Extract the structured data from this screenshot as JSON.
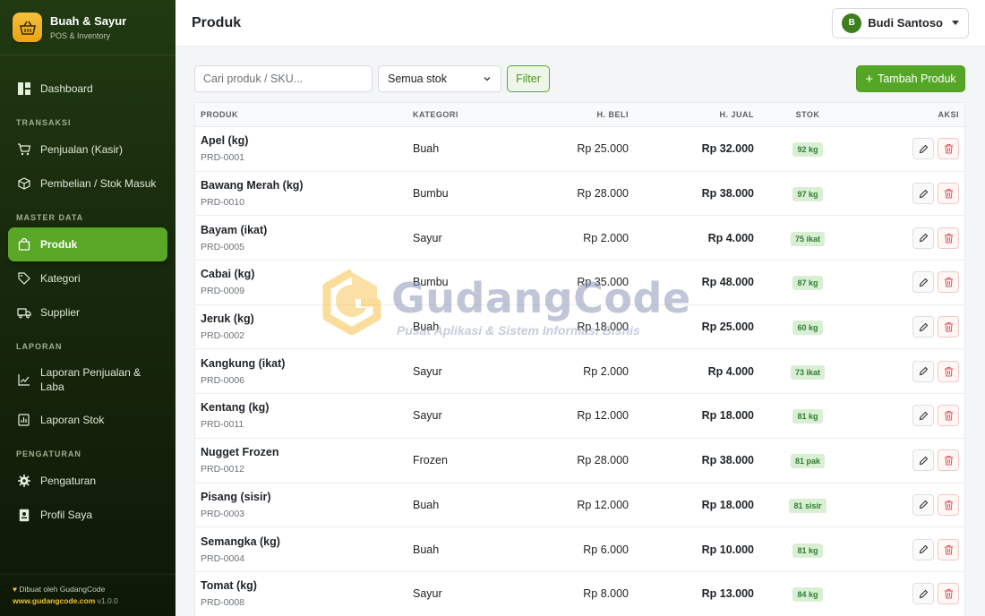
{
  "brand": {
    "name": "Buah & Sayur",
    "tagline": "POS & Inventory"
  },
  "sidebar": {
    "dashboard": "Dashboard",
    "sections": {
      "transaksi": "TRANSAKSI",
      "master": "MASTER DATA",
      "laporan": "LAPORAN",
      "pengaturan": "PENGATURAN"
    },
    "items": {
      "penjualan": "Penjualan (Kasir)",
      "pembelian": "Pembelian / Stok Masuk",
      "produk": "Produk",
      "kategori": "Kategori",
      "supplier": "Supplier",
      "lap_penjualan": "Laporan Penjualan & Laba",
      "lap_stok": "Laporan Stok",
      "pengaturan": "Pengaturan",
      "profil": "Profil Saya"
    },
    "footer": {
      "made_by": "Dibuat oleh GudangCode",
      "url": "www.gudangcode.com",
      "version": "v1.0.0"
    }
  },
  "header": {
    "title": "Produk",
    "user_initial": "B",
    "user_name": "Budi Santoso"
  },
  "toolbar": {
    "search_placeholder": "Cari produk / SKU...",
    "stock_filter": "Semua stok",
    "filter_label": "Filter",
    "add_label": "Tambah Produk"
  },
  "table": {
    "headers": {
      "produk": "PRODUK",
      "kategori": "KATEGORI",
      "beli": "H. BELI",
      "jual": "H. JUAL",
      "stok": "STOK",
      "aksi": "AKSI"
    },
    "rows": [
      {
        "name": "Apel (kg)",
        "sku": "PRD-0001",
        "kategori": "Buah",
        "beli": "Rp 25.000",
        "jual": "Rp 32.000",
        "stok": "92 kg"
      },
      {
        "name": "Bawang Merah (kg)",
        "sku": "PRD-0010",
        "kategori": "Bumbu",
        "beli": "Rp 28.000",
        "jual": "Rp 38.000",
        "stok": "97 kg"
      },
      {
        "name": "Bayam (ikat)",
        "sku": "PRD-0005",
        "kategori": "Sayur",
        "beli": "Rp 2.000",
        "jual": "Rp 4.000",
        "stok": "75 ikat"
      },
      {
        "name": "Cabai (kg)",
        "sku": "PRD-0009",
        "kategori": "Bumbu",
        "beli": "Rp 35.000",
        "jual": "Rp 48.000",
        "stok": "87 kg"
      },
      {
        "name": "Jeruk (kg)",
        "sku": "PRD-0002",
        "kategori": "Buah",
        "beli": "Rp 18.000",
        "jual": "Rp 25.000",
        "stok": "60 kg"
      },
      {
        "name": "Kangkung (ikat)",
        "sku": "PRD-0006",
        "kategori": "Sayur",
        "beli": "Rp 2.000",
        "jual": "Rp 4.000",
        "stok": "73 ikat"
      },
      {
        "name": "Kentang (kg)",
        "sku": "PRD-0011",
        "kategori": "Sayur",
        "beli": "Rp 12.000",
        "jual": "Rp 18.000",
        "stok": "81 kg"
      },
      {
        "name": "Nugget Frozen",
        "sku": "PRD-0012",
        "kategori": "Frozen",
        "beli": "Rp 28.000",
        "jual": "Rp 38.000",
        "stok": "81 pak"
      },
      {
        "name": "Pisang (sisir)",
        "sku": "PRD-0003",
        "kategori": "Buah",
        "beli": "Rp 12.000",
        "jual": "Rp 18.000",
        "stok": "81 sisir"
      },
      {
        "name": "Semangka (kg)",
        "sku": "PRD-0004",
        "kategori": "Buah",
        "beli": "Rp 6.000",
        "jual": "Rp 10.000",
        "stok": "81 kg"
      },
      {
        "name": "Tomat (kg)",
        "sku": "PRD-0008",
        "kategori": "Sayur",
        "beli": "Rp 8.000",
        "jual": "Rp 13.000",
        "stok": "84 kg"
      }
    ]
  },
  "watermark": {
    "title": "GudangCode",
    "subtitle": "Pusat Aplikasi & Sistem Informasi Bisnis"
  },
  "colors": {
    "accent": "#5aa728",
    "sidebar_bg": "#17280c",
    "logo": "#f1b628",
    "badge_bg": "#d9efd4",
    "badge_text": "#2e7d32",
    "delete": "#e05555"
  }
}
